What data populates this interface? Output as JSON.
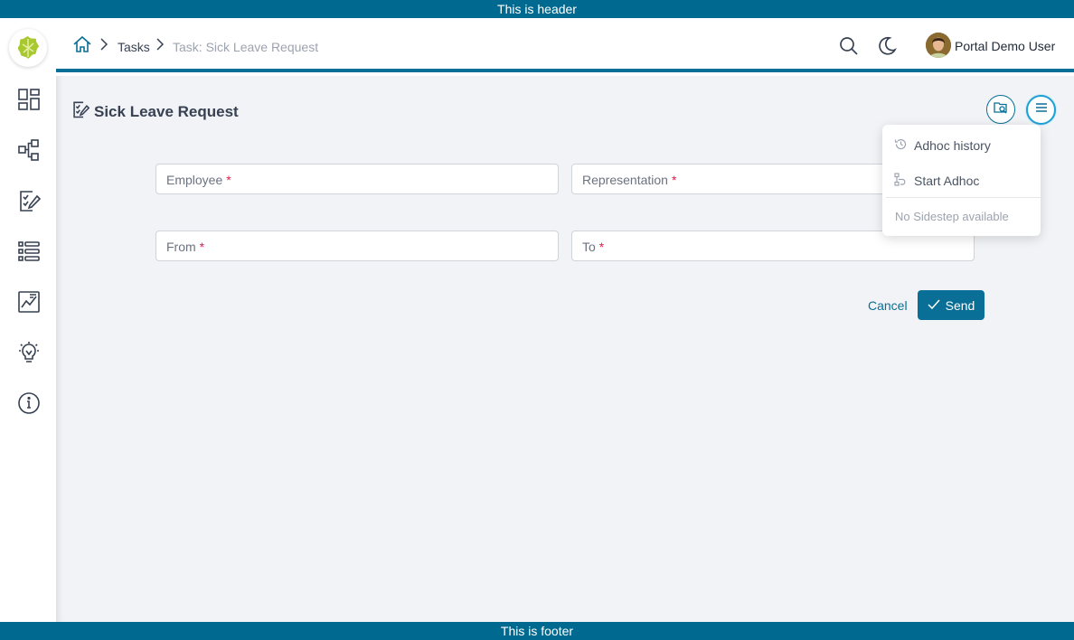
{
  "banners": {
    "header": "This is header",
    "footer": "This is footer"
  },
  "sidebar": {
    "logo_icon": "leaf-logo-icon",
    "items": [
      {
        "icon": "dashboard-icon"
      },
      {
        "icon": "process-icon"
      },
      {
        "icon": "task-edit-icon"
      },
      {
        "icon": "list-icon"
      },
      {
        "icon": "statistics-icon"
      },
      {
        "icon": "idea-bulb-icon"
      },
      {
        "icon": "info-icon"
      }
    ]
  },
  "topbar": {
    "breadcrumb": {
      "home_icon": "home-icon",
      "tasks": "Tasks",
      "current": "Task: Sick Leave Request"
    },
    "search_icon": "search-icon",
    "theme_icon": "moon-icon",
    "user_name": "Portal Demo User"
  },
  "page": {
    "title": "Sick Leave Request",
    "title_icon": "task-edit-icon",
    "fields": [
      {
        "label": "Employee",
        "required_mark": "*"
      },
      {
        "label": "Representation",
        "required_mark": "*"
      },
      {
        "label": "From",
        "required_mark": "*"
      },
      {
        "label": "To",
        "required_mark": "*"
      }
    ],
    "cancel_label": "Cancel",
    "send_label": "Send"
  },
  "actions_menu": {
    "items": [
      {
        "label": "Adhoc history",
        "icon": "history-icon"
      },
      {
        "label": "Start Adhoc",
        "icon": "adhoc-flow-icon"
      }
    ],
    "disabled_note": "No Sidestep available"
  },
  "colors": {
    "primary": "#0a6f96",
    "banner": "#00698f",
    "required": "#e11d48",
    "content_bg": "#f1f3f6"
  }
}
